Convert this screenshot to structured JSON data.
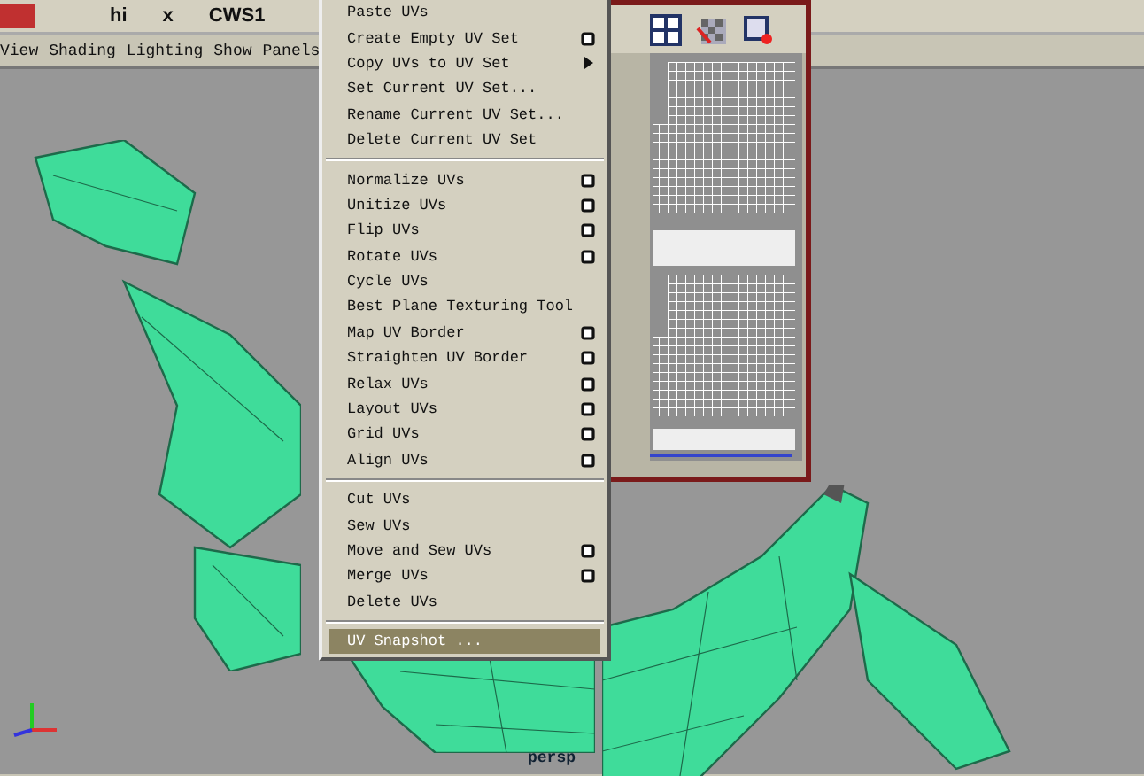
{
  "toolbar": {
    "fields": [
      "hi",
      "x",
      "CWS1"
    ]
  },
  "panel_menu": [
    "View",
    "Shading",
    "Lighting",
    "Show",
    "Panels"
  ],
  "uv_menu": {
    "groups": [
      [
        {
          "label": "Paste UVs",
          "option_box": false,
          "submenu": false,
          "selected": false
        },
        {
          "label": "Create Empty UV Set",
          "option_box": true,
          "submenu": false,
          "selected": false
        },
        {
          "label": "Copy UVs to UV Set",
          "option_box": false,
          "submenu": true,
          "selected": false
        },
        {
          "label": "Set Current UV Set...",
          "option_box": false,
          "submenu": false,
          "selected": false
        },
        {
          "label": "Rename Current UV Set...",
          "option_box": false,
          "submenu": false,
          "selected": false
        },
        {
          "label": "Delete Current UV Set",
          "option_box": false,
          "submenu": false,
          "selected": false
        }
      ],
      [
        {
          "label": "Normalize UVs",
          "option_box": true,
          "submenu": false,
          "selected": false
        },
        {
          "label": "Unitize UVs",
          "option_box": true,
          "submenu": false,
          "selected": false
        },
        {
          "label": "Flip UVs",
          "option_box": true,
          "submenu": false,
          "selected": false
        },
        {
          "label": "Rotate UVs",
          "option_box": true,
          "submenu": false,
          "selected": false
        },
        {
          "label": "Cycle UVs",
          "option_box": false,
          "submenu": false,
          "selected": false
        },
        {
          "label": "Best Plane Texturing Tool",
          "option_box": false,
          "submenu": false,
          "selected": false
        },
        {
          "label": "Map UV Border",
          "option_box": true,
          "submenu": false,
          "selected": false
        },
        {
          "label": "Straighten UV Border",
          "option_box": true,
          "submenu": false,
          "selected": false
        },
        {
          "label": "Relax UVs",
          "option_box": true,
          "submenu": false,
          "selected": false
        },
        {
          "label": "Layout UVs",
          "option_box": true,
          "submenu": false,
          "selected": false
        },
        {
          "label": "Grid UVs",
          "option_box": true,
          "submenu": false,
          "selected": false
        },
        {
          "label": "Align UVs",
          "option_box": true,
          "submenu": false,
          "selected": false
        }
      ],
      [
        {
          "label": "Cut UVs",
          "option_box": false,
          "submenu": false,
          "selected": false
        },
        {
          "label": "Sew UVs",
          "option_box": false,
          "submenu": false,
          "selected": false
        },
        {
          "label": "Move and Sew UVs",
          "option_box": true,
          "submenu": false,
          "selected": false
        },
        {
          "label": "Merge UVs",
          "option_box": true,
          "submenu": false,
          "selected": false
        },
        {
          "label": "Delete UVs",
          "option_box": false,
          "submenu": false,
          "selected": false
        }
      ],
      [
        {
          "label": "UV Snapshot ...",
          "option_box": false,
          "submenu": false,
          "selected": true
        }
      ]
    ]
  },
  "viewport": {
    "camera": "persp"
  }
}
